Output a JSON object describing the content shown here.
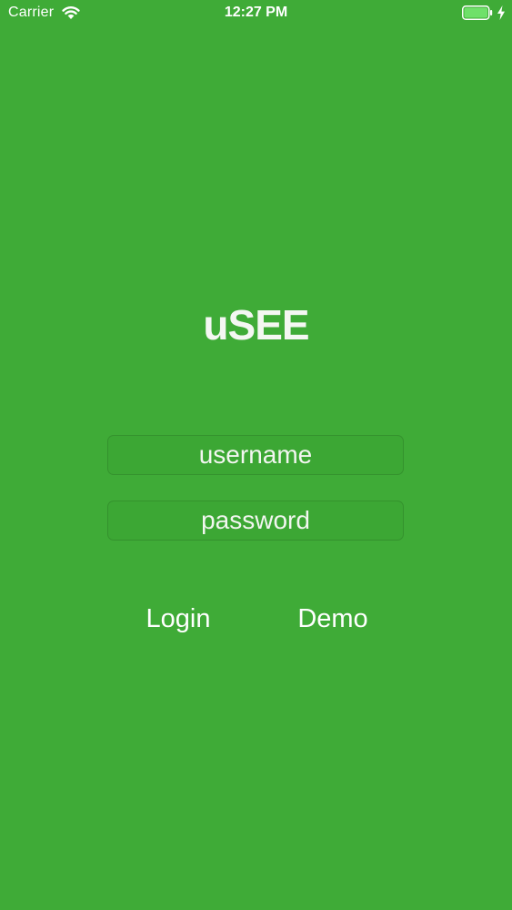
{
  "status_bar": {
    "carrier": "Carrier",
    "time": "12:27 PM",
    "wifi_icon": "wifi-icon",
    "battery_icon": "battery-full-icon",
    "charging_icon": "bolt-icon"
  },
  "app": {
    "logo": "uSEE"
  },
  "login_form": {
    "username_placeholder": "username",
    "username_value": "",
    "password_placeholder": "password",
    "password_value": ""
  },
  "actions": {
    "login_label": "Login",
    "demo_label": "Demo"
  },
  "colors": {
    "background": "#3fab37",
    "text": "#ffffff",
    "battery_fill": "#6fe06a"
  }
}
